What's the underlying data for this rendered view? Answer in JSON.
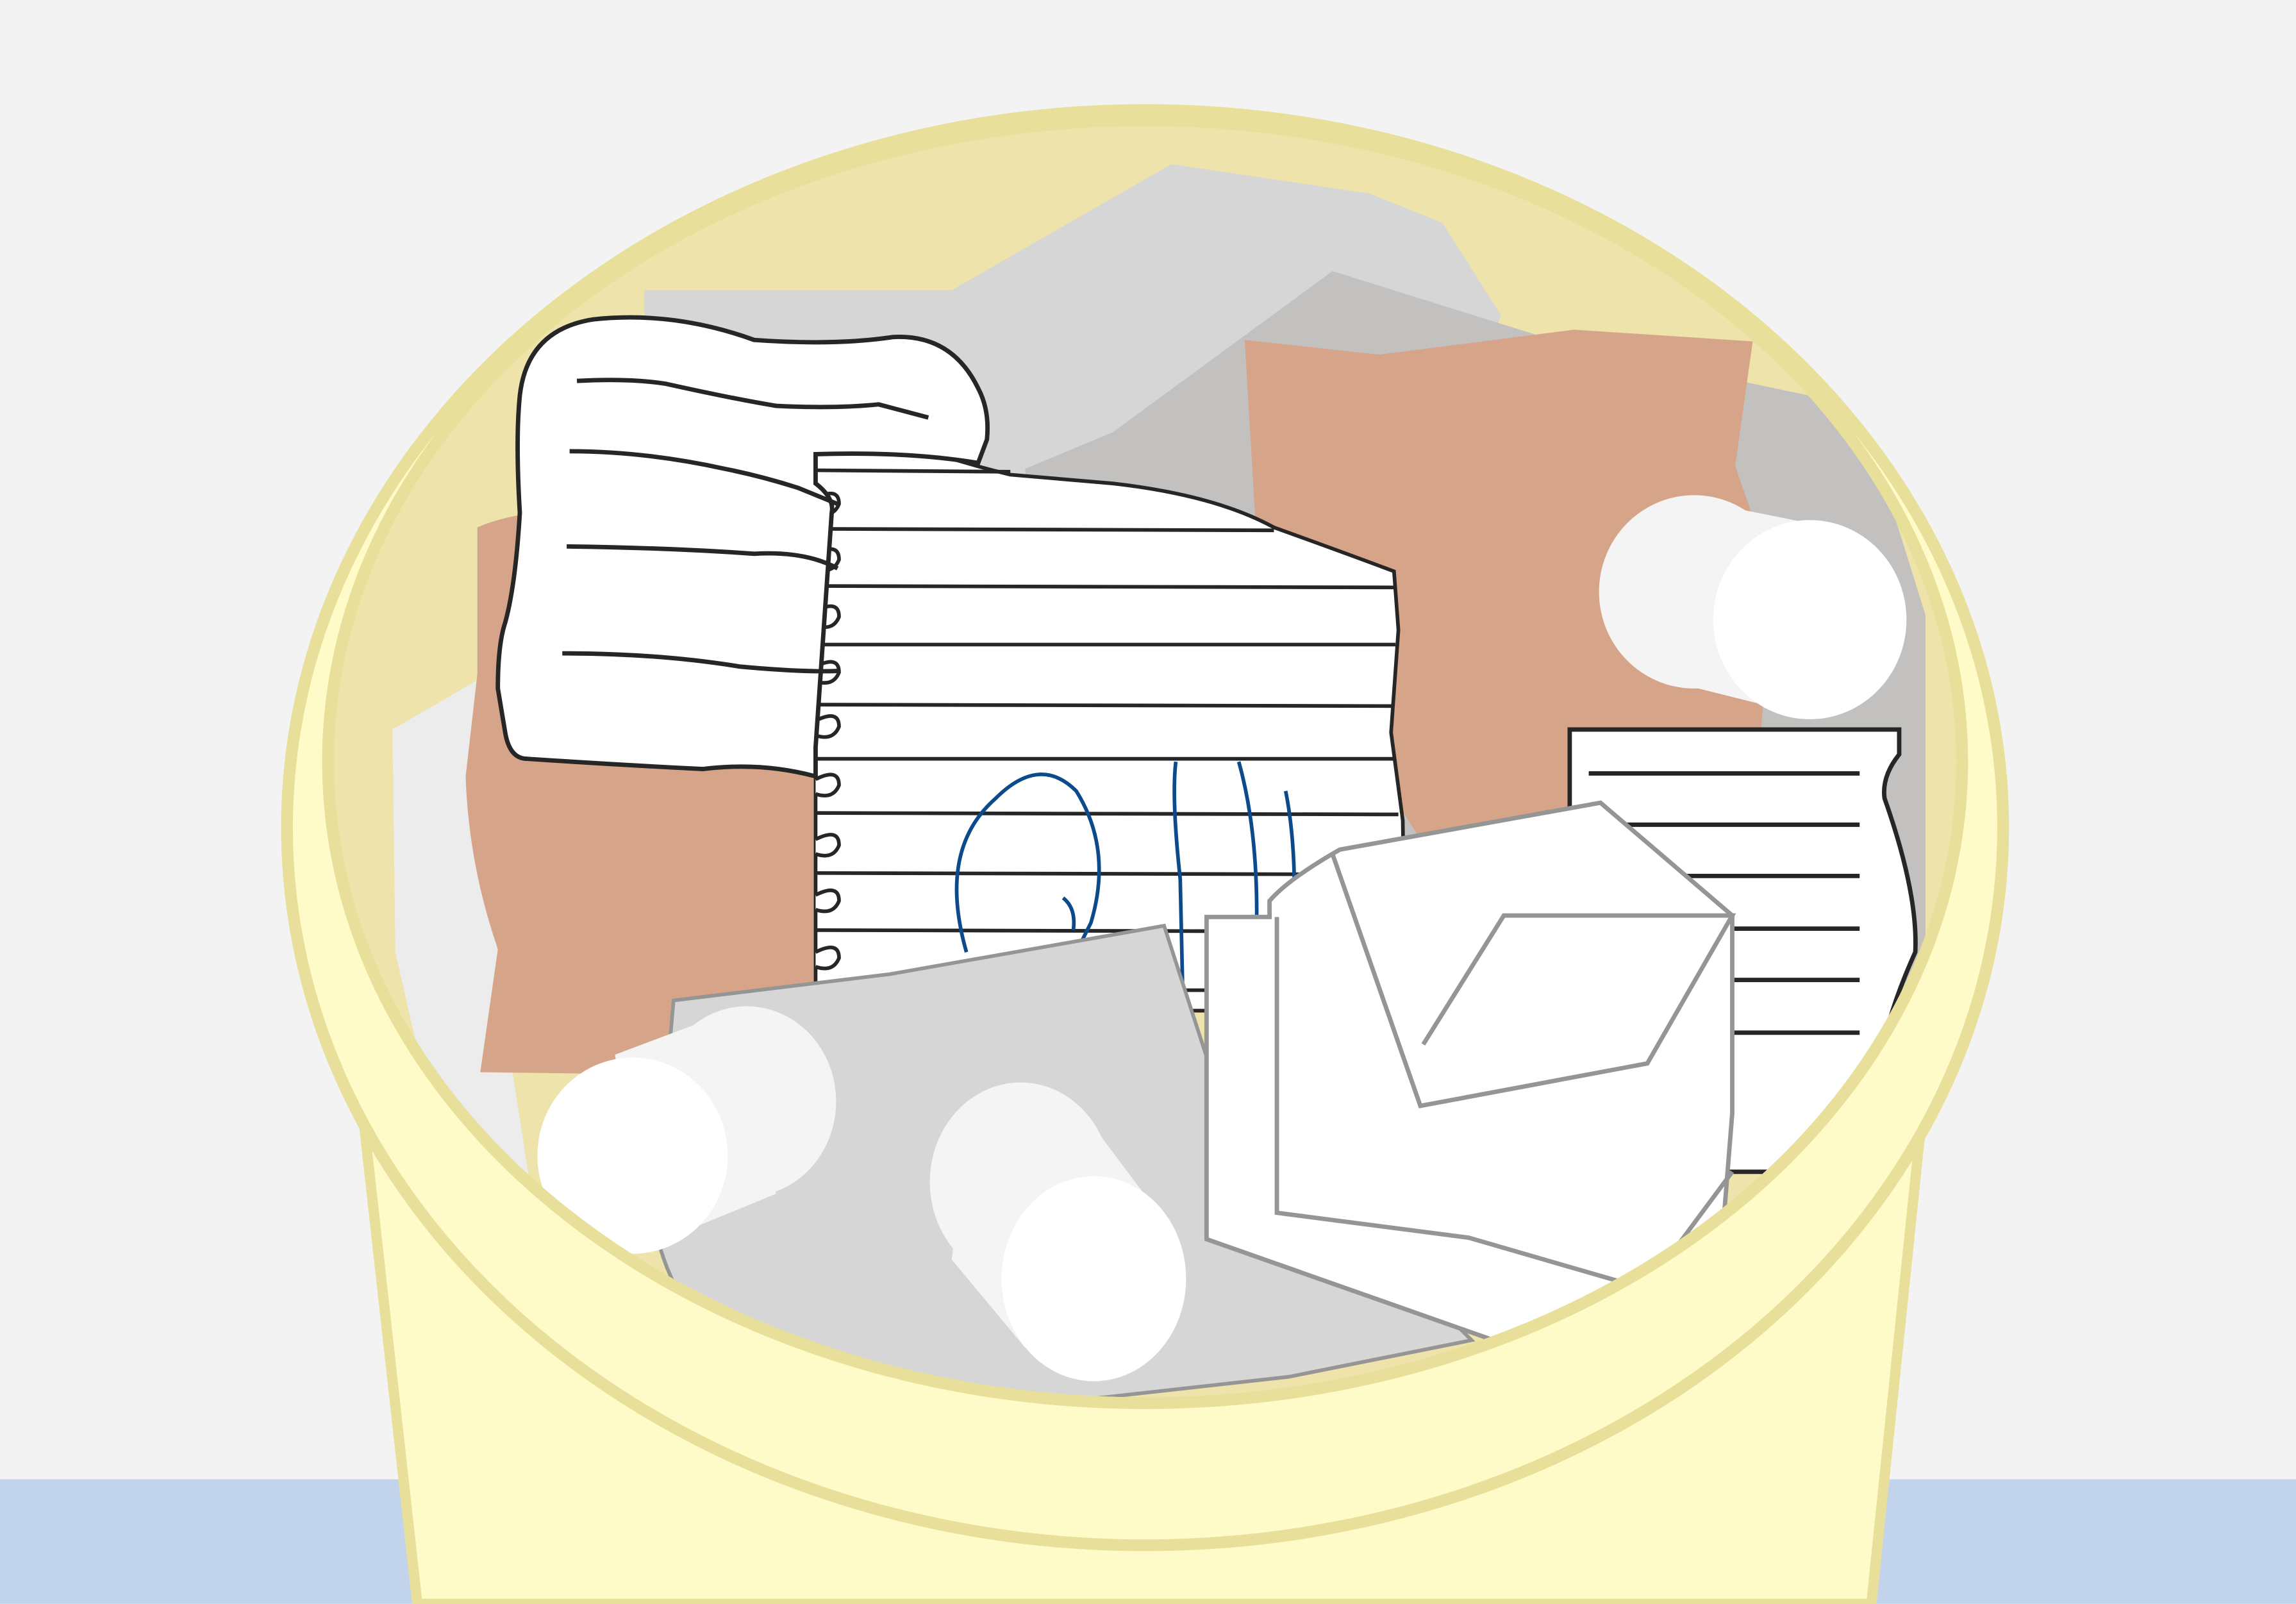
{
  "scene": {
    "colors": {
      "wall": "#f3f3f3",
      "floor": "#c1d4ec",
      "bin_body": "#fefbc9",
      "bin_rim": "#e8e09a",
      "bin_interior": "#ede3ab",
      "paper_white": "#ffffff",
      "paper_shade": "#f4f4f4",
      "paper_grey": "#d6d6d6",
      "paper_dark_grey": "#c2c1bf",
      "kraft": "#d6a589",
      "ink": "#262626",
      "outline_grey": "#959595",
      "scribble_blue": "#0d4a8c"
    },
    "icons": [
      "trash-bin-icon",
      "crumpled-paper-icon",
      "notebook-page-icon",
      "envelope-icon",
      "paper-roll-icon"
    ]
  }
}
